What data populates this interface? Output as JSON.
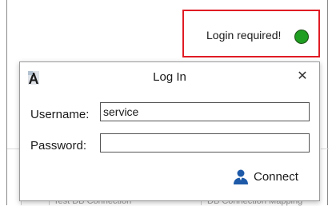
{
  "status": {
    "text": "Login required!",
    "indicator_color": "#1f9e22",
    "highlight_color": "#e01b24"
  },
  "dialog": {
    "title": "Log In",
    "app_icon": "app-logo-icon",
    "close_icon": "close-icon",
    "close_glyph": "✕",
    "username_label": "Username:",
    "username_value": "service",
    "password_label": "Password:",
    "password_value": "",
    "connect_label": "Connect",
    "connect_icon": "user-icon"
  },
  "background_partial_texts": [
    "Test DB Connection",
    "DB Connection Mapping"
  ]
}
